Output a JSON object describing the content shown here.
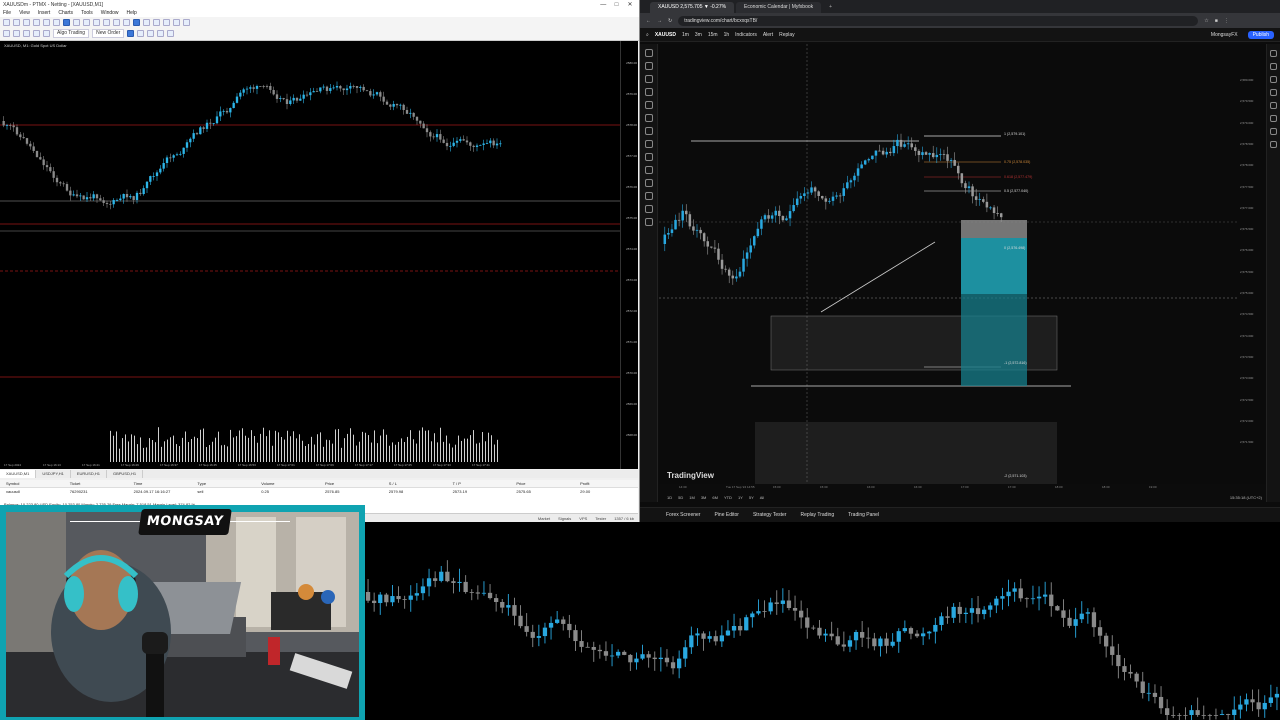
{
  "mt5": {
    "title": "XAUUSDm - PTMX - Netting - [XAUUSD,M1]",
    "window_buttons": [
      "—",
      "□",
      "✕"
    ],
    "menu": [
      "File",
      "View",
      "Insert",
      "Charts",
      "Tools",
      "Window",
      "Help"
    ],
    "toolbar": {
      "algo_trading_label": "Algo Trading",
      "new_order_label": "New Order"
    },
    "chart_title": "XAUUSD, M1: Gold Spot US Dollar",
    "price_labels": [
      "2580.00",
      "2579.00",
      "2578.00",
      "2577.00",
      "2576.00",
      "2575.00",
      "2574.00",
      "2573.00",
      "2572.00",
      "2571.00",
      "2570.00",
      "2569.00",
      "2568.00"
    ],
    "time_labels": [
      "17 Sep 2024",
      "17 Sep 16:13",
      "17 Sep 16:21",
      "17 Sep 16:29",
      "17 Sep 16:37",
      "17 Sep 16:45",
      "17 Sep 16:53",
      "17 Sep 17:01",
      "17 Sep 17:09",
      "17 Sep 17:17",
      "17 Sep 17:25",
      "17 Sep 17:33",
      "17 Sep 17:41"
    ],
    "chart_tabs": [
      "XAUUSD,M1",
      "USDJPY,H1",
      "EURUSD,H1",
      "GBPUSD,H1"
    ],
    "terminal": {
      "headers": [
        "Symbol",
        "Ticket",
        "Time",
        "Type",
        "Volume",
        "Price",
        "S / L",
        "T / P",
        "Price",
        "Profit"
      ],
      "row": [
        "xauusdl",
        "76290231",
        "2024.09.17 16:16:27",
        "sell",
        "0.25",
        "2576.85",
        "2579.98",
        "2573.19",
        "2575.65",
        "29.00"
      ],
      "balance": "Balance: 10 223.80 USD  Equity: 10 253.80  Margin: 2 735.29  Free Margin: 7 518.51  Margin Level: 374.82 %"
    },
    "status": {
      "left": "Default",
      "right": [
        "Market",
        "Signals",
        "VPS",
        "Tester"
      ],
      "ping": "1357 / 6 kb"
    }
  },
  "tv": {
    "browser_tabs": [
      "XAUUSD 2,575.705 ▼ -0.27%",
      "Economic Calendar | Myfxbook"
    ],
    "new_tab": "+",
    "url": "tradingview.com/chart/bcxxqsTB/",
    "symbol": "XAUUSD",
    "timeframes": [
      "1m",
      "3m",
      "15m",
      "1h"
    ],
    "indicators_label": "Indicators",
    "alert_label": "Alert",
    "replay_label": "Replay",
    "account": "MongsayFX",
    "publish_label": "Publish",
    "price_labels": [
      "2,580.000",
      "2,579.500",
      "2,579.000",
      "2,578.500",
      "2,578.000",
      "2,577.500",
      "2,577.000",
      "2,576.500",
      "2,576.000",
      "2,575.500",
      "2,575.000",
      "2,574.500",
      "2,574.000",
      "2,573.500",
      "2,573.000",
      "2,572.500",
      "2,572.000",
      "2,571.500"
    ],
    "time_labels": [
      "14:30",
      "Tue 17 Sep '24  14:55",
      "15:00",
      "15:30",
      "16:00",
      "16:30",
      "17:00",
      "17:30",
      "18:00",
      "18:30",
      "19:00"
    ],
    "fib_labels": [
      "1 (2,579.101)",
      "0.75 (2,578.035)",
      "0.618 (2,577.479)",
      "0.5 (2,577.040)",
      "0 (2,576.498)",
      "-1 (2,572.816)",
      "-2 (2,571.103)"
    ],
    "tf_bar": [
      "1D",
      "5D",
      "1M",
      "3M",
      "6M",
      "YTD",
      "1Y",
      "5Y",
      "All"
    ],
    "clock": "15:35:18 (UTC+2)",
    "watermark": "TradingView",
    "bottom_tabs": [
      "Forex Screener",
      "Pine Editor",
      "Strategy Tester",
      "Replay Trading",
      "Trading Panel"
    ]
  },
  "webcam": {
    "logo": "MONGSAY"
  },
  "colors": {
    "bull": "#2cb5e8",
    "bear": "#8a8a8a",
    "bull_tv": "#29a8e0",
    "accent": "#2962ff",
    "webcam_border": "#0fa3b1"
  }
}
